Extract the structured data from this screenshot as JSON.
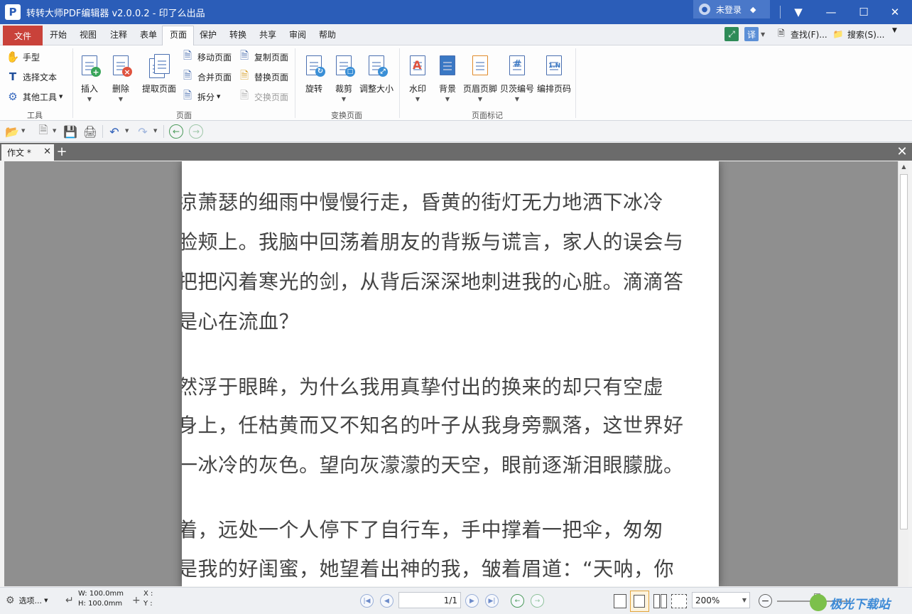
{
  "titlebar": {
    "title": "转转大师PDF编辑器 v2.0.0.2 - 印了么出品",
    "logo": "P",
    "login": "未登录",
    "buttons": {
      "ribbon_toggle": "▼",
      "minimize": "—",
      "maximize": "☐",
      "close": "✕"
    }
  },
  "menu": {
    "file": "文件",
    "items": [
      "开始",
      "视图",
      "注释",
      "表单",
      "页面",
      "保护",
      "转换",
      "共享",
      "审阅",
      "帮助"
    ],
    "active": "页面",
    "right": {
      "find": "查找(F)...",
      "search": "搜索(S)...",
      "translate_glyph": "译"
    }
  },
  "ribbon": {
    "tools": {
      "hand": "手型",
      "select_text": "选择文本",
      "other_tools": "其他工具",
      "group": "工具"
    },
    "pages": {
      "insert": "插入",
      "delete": "删除",
      "extract": "提取页面",
      "move": "移动页面",
      "merge": "合并页面",
      "split": "拆分",
      "copy": "复制页面",
      "replace": "替换页面",
      "swap": "交换页面",
      "group": "页面"
    },
    "transform": {
      "rotate": "旋转",
      "crop": "裁剪",
      "resize": "调整大小",
      "group": "变换页面"
    },
    "marks": {
      "watermark": "水印",
      "background": "背景",
      "header_footer": "页眉页脚",
      "bates": "贝茨编号",
      "page_number": "编排页码",
      "group": "页面标记"
    }
  },
  "tab": {
    "name": "作文 *",
    "add": "+",
    "close": "✕"
  },
  "document": {
    "lines": [
      "凉萧瑟的细雨中慢慢行走，昏黄的街灯无力地洒下冰冷",
      "脸颊上。我脑中回荡着朋友的背叛与谎言，家人的误会与",
      "把把闪着寒光的剑，从背后深深地刺进我的心脏。滴滴答",
      "是心在流血？",
      "",
      "然浮于眼眸，为什么我用真挚付出的换来的却只有空虚",
      "身上，任枯黄而又不知名的叶子从我身旁飘落，这世界好",
      "一冰冷的灰色。望向灰濛濛的天空，眼前逐渐泪眼朦胧。",
      "",
      "着，远处一个人停下了自行车，手中撑着一把伞，匆匆",
      "是我的好闺蜜，她望着出神的我，皱着眉道：“天呐，你"
    ]
  },
  "statusbar": {
    "options": "选项...",
    "width": "W: 100.0mm",
    "height": "H: 100.0mm",
    "x": "X :",
    "y": "Y :",
    "page": "1/1",
    "zoom": "200%",
    "watermark_text": "极光下载站"
  },
  "colors": {
    "titlebar": "#2b5db8",
    "file_menu": "#c9423a",
    "accent_green": "#4a9a5a",
    "background_gray": "#8f8f8f"
  }
}
